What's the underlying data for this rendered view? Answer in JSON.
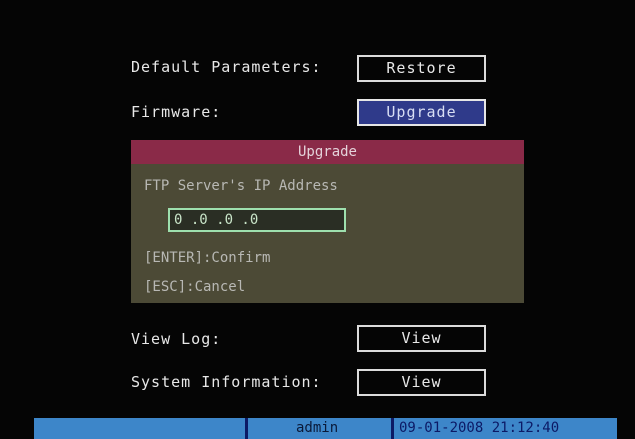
{
  "rows": {
    "default_params": {
      "label": "Default Parameters:",
      "button": "Restore"
    },
    "firmware": {
      "label": "Firmware:",
      "button": "Upgrade"
    },
    "view_log": {
      "label": "View Log:",
      "button": "View"
    },
    "system_info": {
      "label": "System Information:",
      "button": "View"
    }
  },
  "dialog": {
    "title": "Upgrade",
    "prompt": "FTP Server's IP Address",
    "ip_value": "0 .0 .0 .0",
    "enter_hint": "[ENTER]:Confirm",
    "esc_hint": "[ESC]:Cancel"
  },
  "status_bar": {
    "user": "admin",
    "datetime": "09-01-2008 21:12:40"
  },
  "colors": {
    "selected_button": "#2f3a8a",
    "dialog_body": "#4c4a36",
    "dialog_title": "#8a2a48",
    "status_bar": "#3d86c9"
  }
}
